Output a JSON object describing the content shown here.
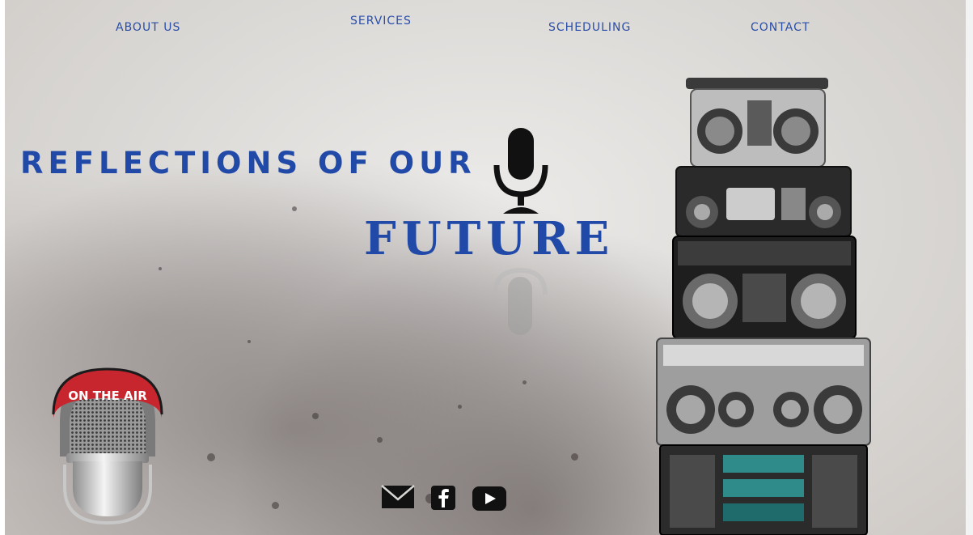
{
  "nav": {
    "about": "ABOUT US",
    "services": "SERVICES",
    "scheduling": "SCHEDULING",
    "contact": "CONTACT"
  },
  "hero": {
    "line1": "REFLECTIONS OF OUR",
    "line2": "FUTURE"
  },
  "badge": {
    "text": "ON THE AIR"
  },
  "social": {
    "icons": [
      "email-icon",
      "facebook-icon",
      "youtube-icon"
    ]
  },
  "colors": {
    "accent": "#2149a8",
    "badge_red": "#c7262e"
  }
}
